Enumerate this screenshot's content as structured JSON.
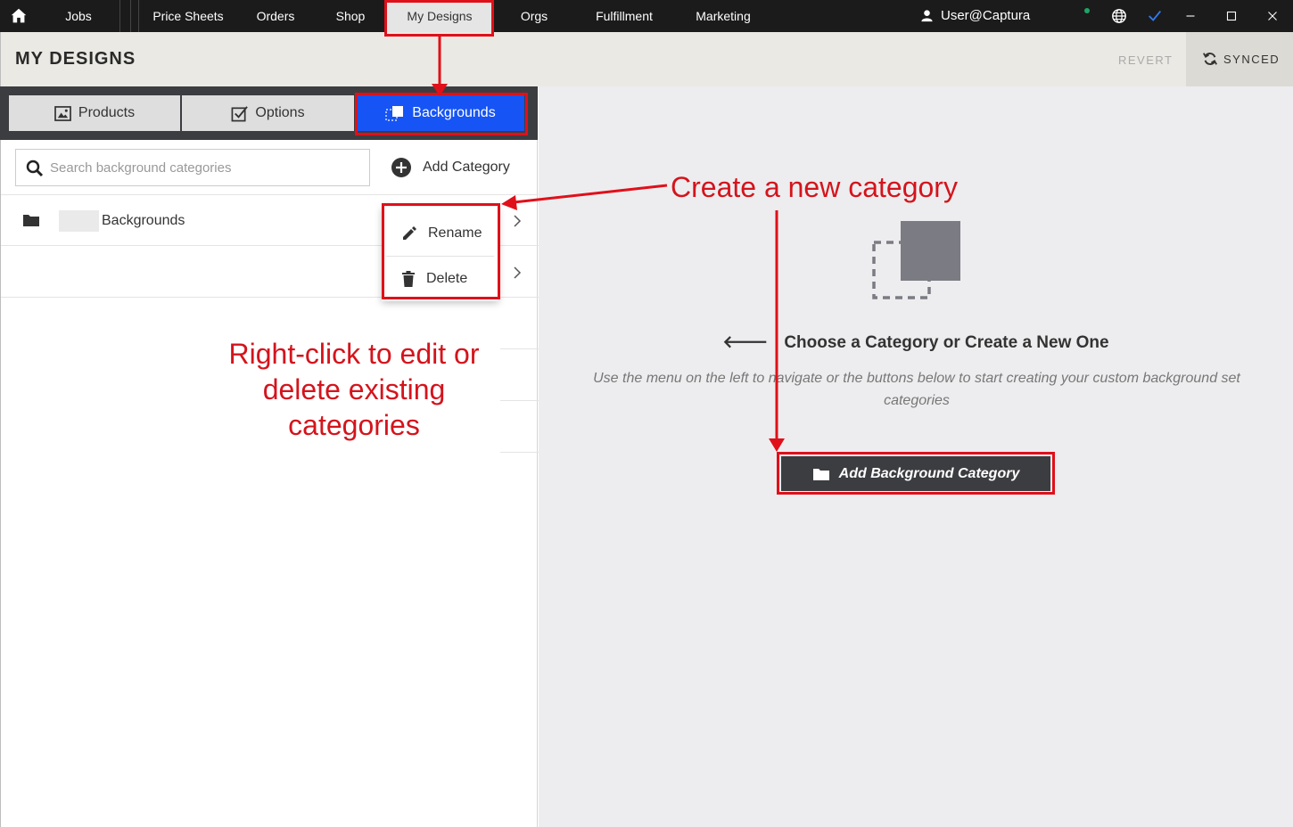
{
  "nav": {
    "items": [
      {
        "label": "Jobs"
      },
      {
        "label": "Price Sheets"
      },
      {
        "label": "Orders"
      },
      {
        "label": "Shop"
      },
      {
        "label": "My Designs"
      },
      {
        "label": "Orgs"
      },
      {
        "label": "Fulfillment"
      },
      {
        "label": "Marketing"
      }
    ],
    "user": "User@Captura"
  },
  "header": {
    "title": "MY DESIGNS",
    "revert": "REVERT",
    "synced": "SYNCED"
  },
  "tabs": [
    {
      "label": "Products",
      "icon": "image-icon"
    },
    {
      "label": "Options",
      "icon": "checkbox-icon"
    },
    {
      "label": "Backgrounds",
      "icon": "background-icon"
    }
  ],
  "search": {
    "placeholder": "Search background categories"
  },
  "add_category": "Add Category",
  "categories": [
    {
      "label": "Backgrounds"
    }
  ],
  "context_menu": {
    "rename": "Rename",
    "delete": "Delete"
  },
  "main": {
    "heading": "Choose a Category or Create a New One",
    "description": "Use the menu on the left to navigate or the buttons below to start creating your custom background set categories",
    "add_button": "Add Background Category"
  },
  "annotations": {
    "create": "Create a new category",
    "rightclick": "Right-click to edit or delete existing categories"
  },
  "colors": {
    "accent": "#1654f5",
    "annotation": "#e0101a",
    "dark": "#3c3d41"
  }
}
